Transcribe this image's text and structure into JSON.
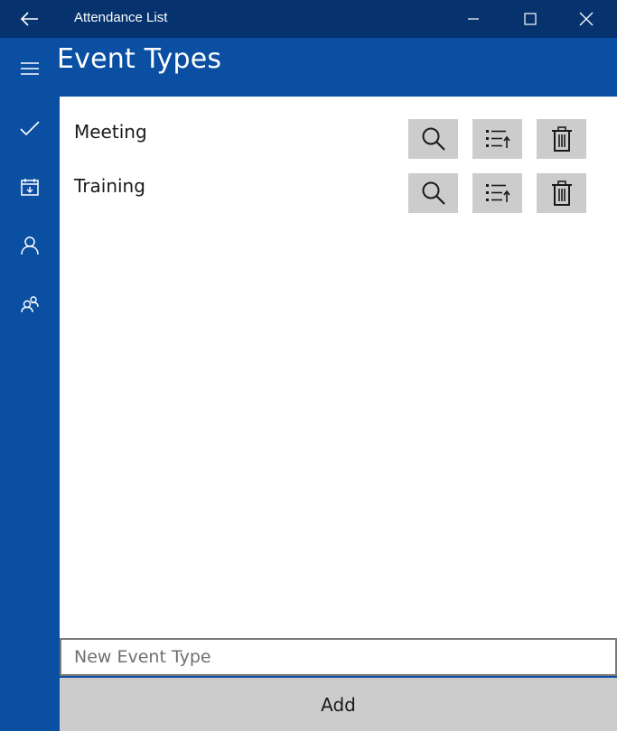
{
  "window": {
    "title": "Attendance List",
    "back_icon": "back-arrow-icon",
    "minimize_icon": "minimize-icon",
    "maximize_icon": "maximize-icon",
    "close_icon": "close-icon"
  },
  "nav": {
    "items": [
      {
        "icon": "hamburger-menu-icon"
      },
      {
        "icon": "checkmark-icon"
      },
      {
        "icon": "calendar-icon"
      },
      {
        "icon": "person-icon"
      },
      {
        "icon": "people-icon"
      }
    ]
  },
  "header": {
    "title": "Event Types"
  },
  "event_types": [
    {
      "label": "Meeting"
    },
    {
      "label": "Training"
    }
  ],
  "actions": {
    "search_icon": "search-icon",
    "list_icon": "sort-list-icon",
    "delete_icon": "trash-icon"
  },
  "new_event": {
    "value": "",
    "placeholder": "New Event Type"
  },
  "add_button": {
    "label": "Add"
  },
  "colors": {
    "title_bar": "#06336e",
    "accent": "#0b4fa3",
    "content_bg": "#ffffff",
    "button_gray": "#cccccc"
  }
}
